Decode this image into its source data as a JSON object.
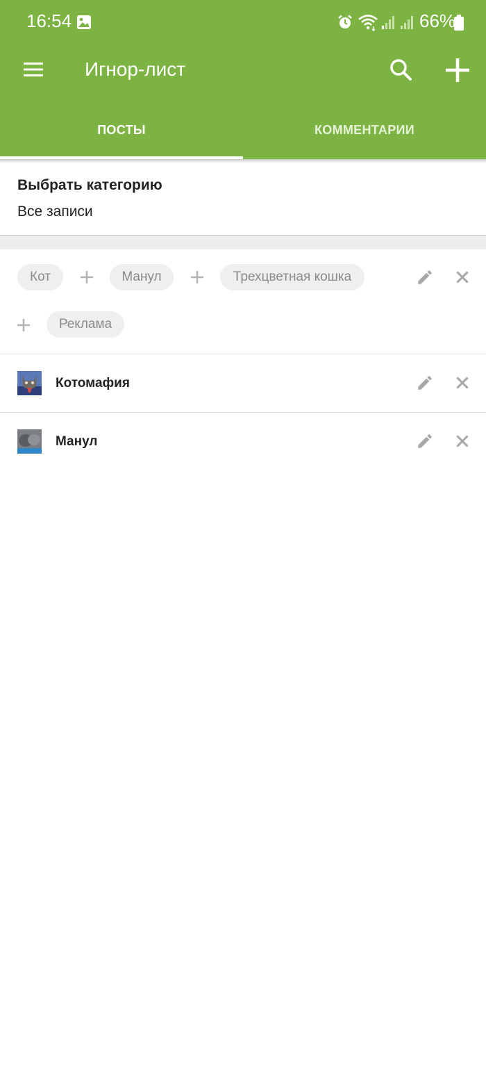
{
  "status_bar": {
    "time": "16:54",
    "battery": "66%",
    "icons": [
      "gallery-icon",
      "alarm-icon",
      "wifi-icon",
      "signal-icon",
      "signal-icon",
      "battery-icon"
    ]
  },
  "toolbar": {
    "title": "Игнор-лист",
    "menu_icon": "menu-icon",
    "search_icon": "search-icon",
    "add_icon": "add-icon"
  },
  "tabs": [
    {
      "label": "ПОСТЫ",
      "active": true
    },
    {
      "label": "КОММЕНТАРИИ",
      "active": false
    }
  ],
  "category": {
    "label": "Выбрать категорию",
    "value": "Все записи"
  },
  "tag_rule": {
    "tags": [
      "Кот",
      "Манул",
      "Трехцветная кошка",
      "Реклама"
    ],
    "edit_icon": "pencil-icon",
    "delete_icon": "close-icon"
  },
  "communities": [
    {
      "name": "Котомафия",
      "avatar_icon": "cat-avatar"
    },
    {
      "name": "Манул",
      "avatar_icon": "manul-avatar"
    }
  ],
  "colors": {
    "primary": "#7cb342",
    "chip_bg": "#efefef",
    "chip_text": "#8a8a8a",
    "icon_gray": "#a8a8a8"
  }
}
